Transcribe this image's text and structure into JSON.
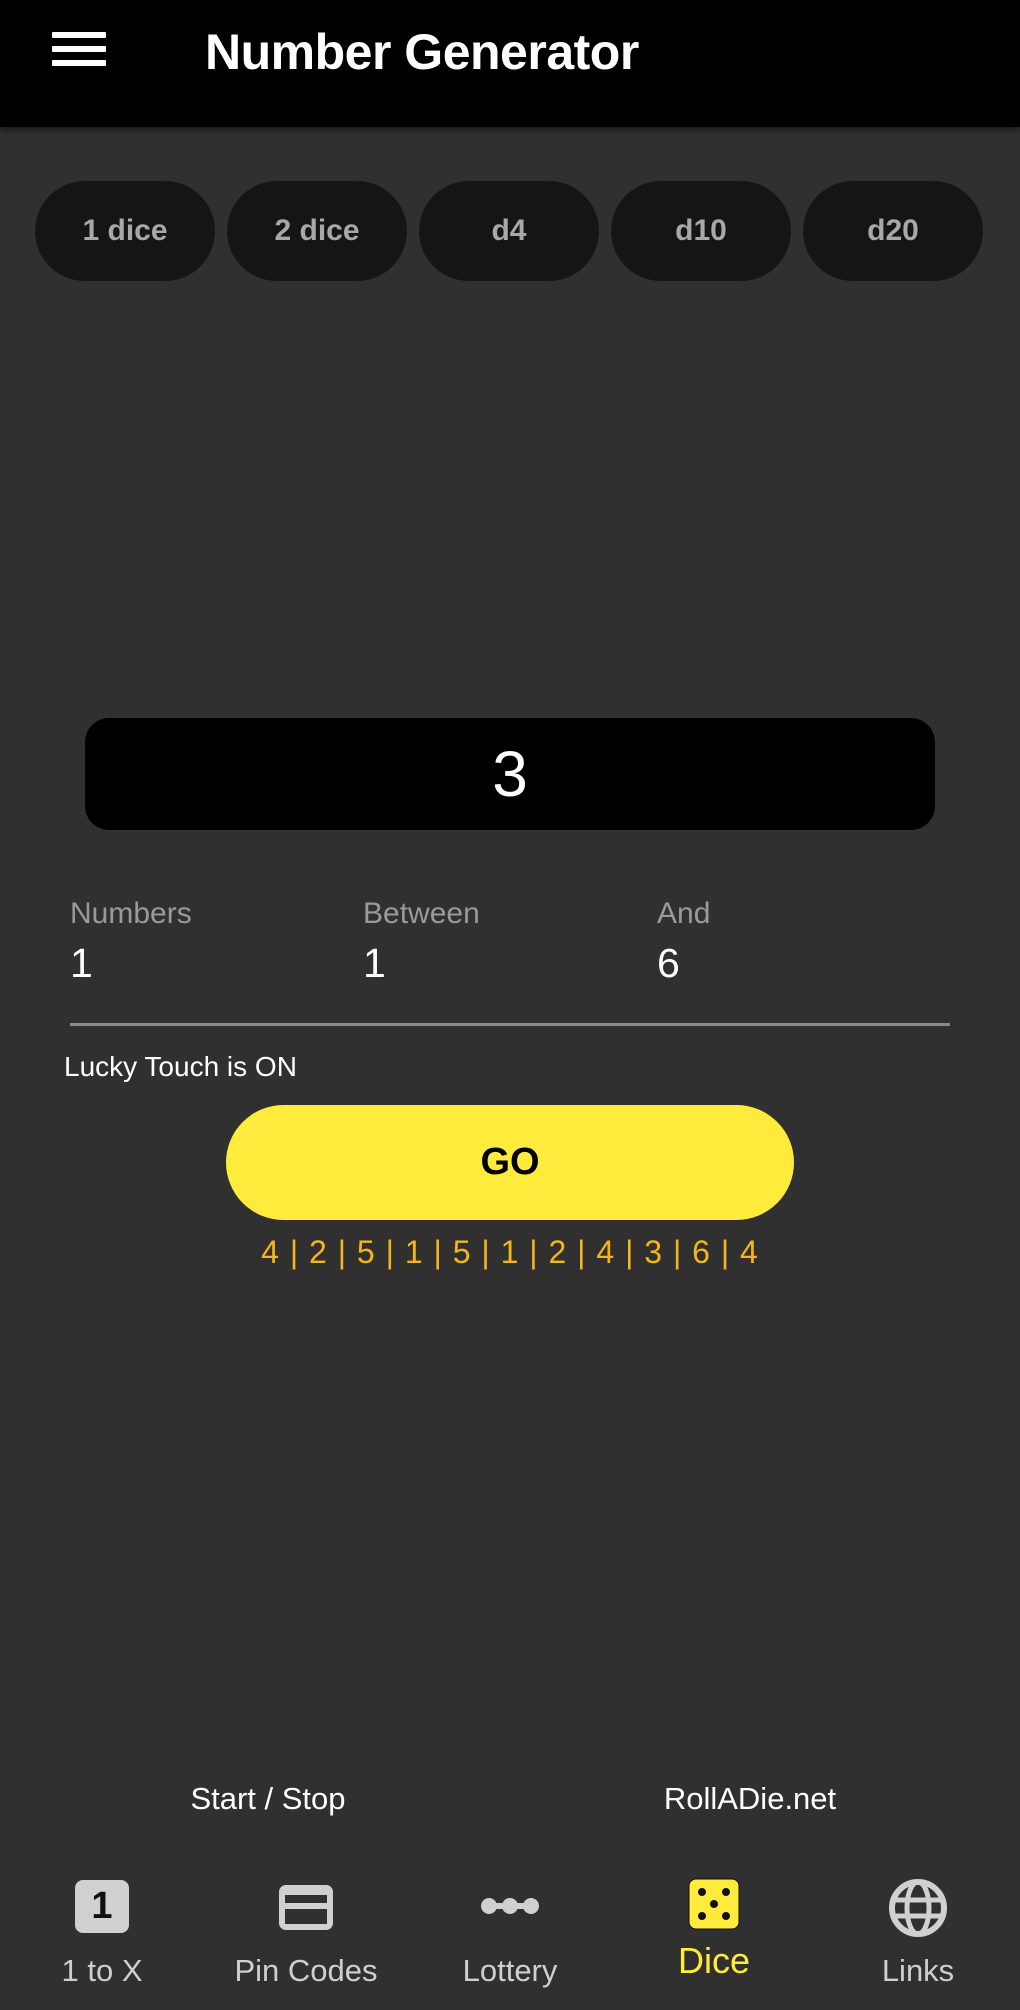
{
  "header": {
    "title": "Number Generator",
    "menu_icon": "hamburger-menu-icon"
  },
  "presets": [
    {
      "label": "1 dice"
    },
    {
      "label": "2 dice"
    },
    {
      "label": "d4"
    },
    {
      "label": "d10"
    },
    {
      "label": "d20"
    }
  ],
  "result": {
    "value": "3"
  },
  "fields": [
    {
      "label": "Numbers",
      "value": "1"
    },
    {
      "label": "Between",
      "value": "1"
    },
    {
      "label": "And",
      "value": "6"
    }
  ],
  "lucky_touch": "Lucky Touch is ON",
  "go_label": "GO",
  "history": "4 | 2 | 5 | 1 | 5 | 1 | 2 | 4 | 3 | 6 | 4",
  "footer": {
    "start_stop": "Start / Stop",
    "site_link": "RollADie.net"
  },
  "nav": {
    "items": [
      {
        "label": "1 to X",
        "icon": "number-one-icon",
        "icon_glyph": "1",
        "active": false
      },
      {
        "label": "Pin Codes",
        "icon": "card-icon",
        "active": false
      },
      {
        "label": "Lottery",
        "icon": "lottery-dots-icon",
        "active": false
      },
      {
        "label": "Dice",
        "icon": "dice-icon",
        "active": true
      },
      {
        "label": "Links",
        "icon": "globe-icon",
        "active": false
      }
    ]
  },
  "colors": {
    "background": "#303030",
    "header": "#000000",
    "accent": "#ffeb3b",
    "history": "#f5b51f",
    "chip": "#151515"
  }
}
